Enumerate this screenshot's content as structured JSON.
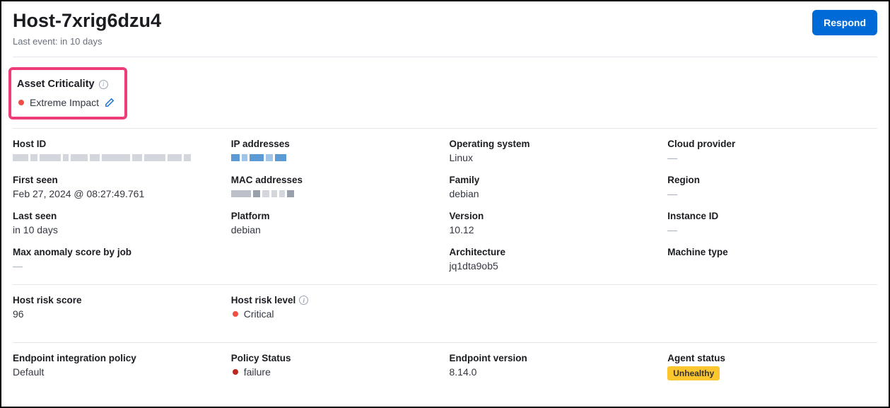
{
  "header": {
    "title": "Host-7xrig6dzu4",
    "last_event_label": "Last event: in 10 days",
    "respond_label": "Respond"
  },
  "criticality": {
    "label": "Asset Criticality",
    "value": "Extreme Impact"
  },
  "fields": {
    "host_id_label": "Host ID",
    "first_seen_label": "First seen",
    "first_seen_value": "Feb 27, 2024 @ 08:27:49.761",
    "last_seen_label": "Last seen",
    "last_seen_value": "in 10 days",
    "max_anomaly_label": "Max anomaly score by job",
    "max_anomaly_value": "—",
    "ip_label": "IP addresses",
    "mac_label": "MAC addresses",
    "platform_label": "Platform",
    "platform_value": "debian",
    "os_label": "Operating system",
    "os_value": "Linux",
    "family_label": "Family",
    "family_value": "debian",
    "version_label": "Version",
    "version_value": "10.12",
    "arch_label": "Architecture",
    "arch_value": "jq1dta9ob5",
    "cloud_label": "Cloud provider",
    "cloud_value": "—",
    "region_label": "Region",
    "region_value": "—",
    "instance_label": "Instance ID",
    "instance_value": "—",
    "machine_label": "Machine type"
  },
  "risk": {
    "score_label": "Host risk score",
    "score_value": "96",
    "level_label": "Host risk level",
    "level_value": "Critical"
  },
  "endpoint": {
    "policy_label": "Endpoint integration policy",
    "policy_value": "Default",
    "status_label": "Policy Status",
    "status_value": "failure",
    "version_label": "Endpoint version",
    "version_value": "8.14.0",
    "agent_label": "Agent status",
    "agent_value": "Unhealthy"
  }
}
